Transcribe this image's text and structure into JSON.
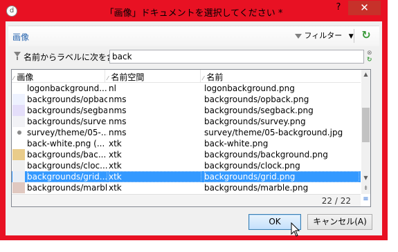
{
  "window": {
    "app_icon_glyph": "d",
    "title": "「画像」ドキュメントを選択してください *",
    "help_glyph": "?",
    "close_glyph": "✕"
  },
  "header": {
    "title": "画像",
    "filter_label": "フィルター",
    "filter_caret": "▼",
    "refresh_glyph": "↻"
  },
  "search": {
    "label": "名前からラベルに次を含む:",
    "value": "back",
    "clear_glyph": "⊗",
    "apply_glyph": "↻"
  },
  "grid": {
    "columns": [
      "画像",
      "名前空間",
      "名前"
    ],
    "sort_glyph": "⁄",
    "rows": [
      {
        "image": "logonbackground....",
        "ns": "nl",
        "name": "logonbackground.png",
        "thumb": ""
      },
      {
        "image": "backgrounds/opbac...",
        "ns": "nms",
        "name": "backgrounds/opback.png",
        "thumb": "#eef2ff"
      },
      {
        "image": "backgrounds/segbac",
        "ns": "nms",
        "name": "backgrounds/segback.png",
        "thumb": "#e4defa"
      },
      {
        "image": "backgrounds/surve...",
        "ns": "nms",
        "name": "backgrounds/survey.png",
        "thumb": "#f2f2f6"
      },
      {
        "image": "survey/theme/05-...",
        "ns": "nms",
        "name": "survey/theme/05-background.jpg",
        "thumb": "dot"
      },
      {
        "image": "back-white.png (...",
        "ns": "xtk",
        "name": "back-white.png",
        "thumb": ""
      },
      {
        "image": "backgrounds/bac...",
        "ns": "xtk",
        "name": "backgrounds/background.png",
        "thumb": "#e9cc8a"
      },
      {
        "image": "backgrounds/cloc...",
        "ns": "xtk",
        "name": "backgrounds/clock.png",
        "thumb": "#f0f0f0"
      },
      {
        "image": "backgrounds/grid....",
        "ns": "xtk",
        "name": "backgrounds/grid.png",
        "thumb": "#e8eef6"
      },
      {
        "image": "backgrounds/marbl...",
        "ns": "xtk",
        "name": "backgrounds/marble.png",
        "thumb": "#e0c8c0"
      }
    ],
    "selected_index": 8,
    "count": "22 / 22",
    "scroll_up": "▲",
    "scroll_down": "▼",
    "nav_end": "⇟",
    "menu_glyph": "≡"
  },
  "buttons": {
    "ok": "OK",
    "cancel": "キャンセル(A)"
  }
}
